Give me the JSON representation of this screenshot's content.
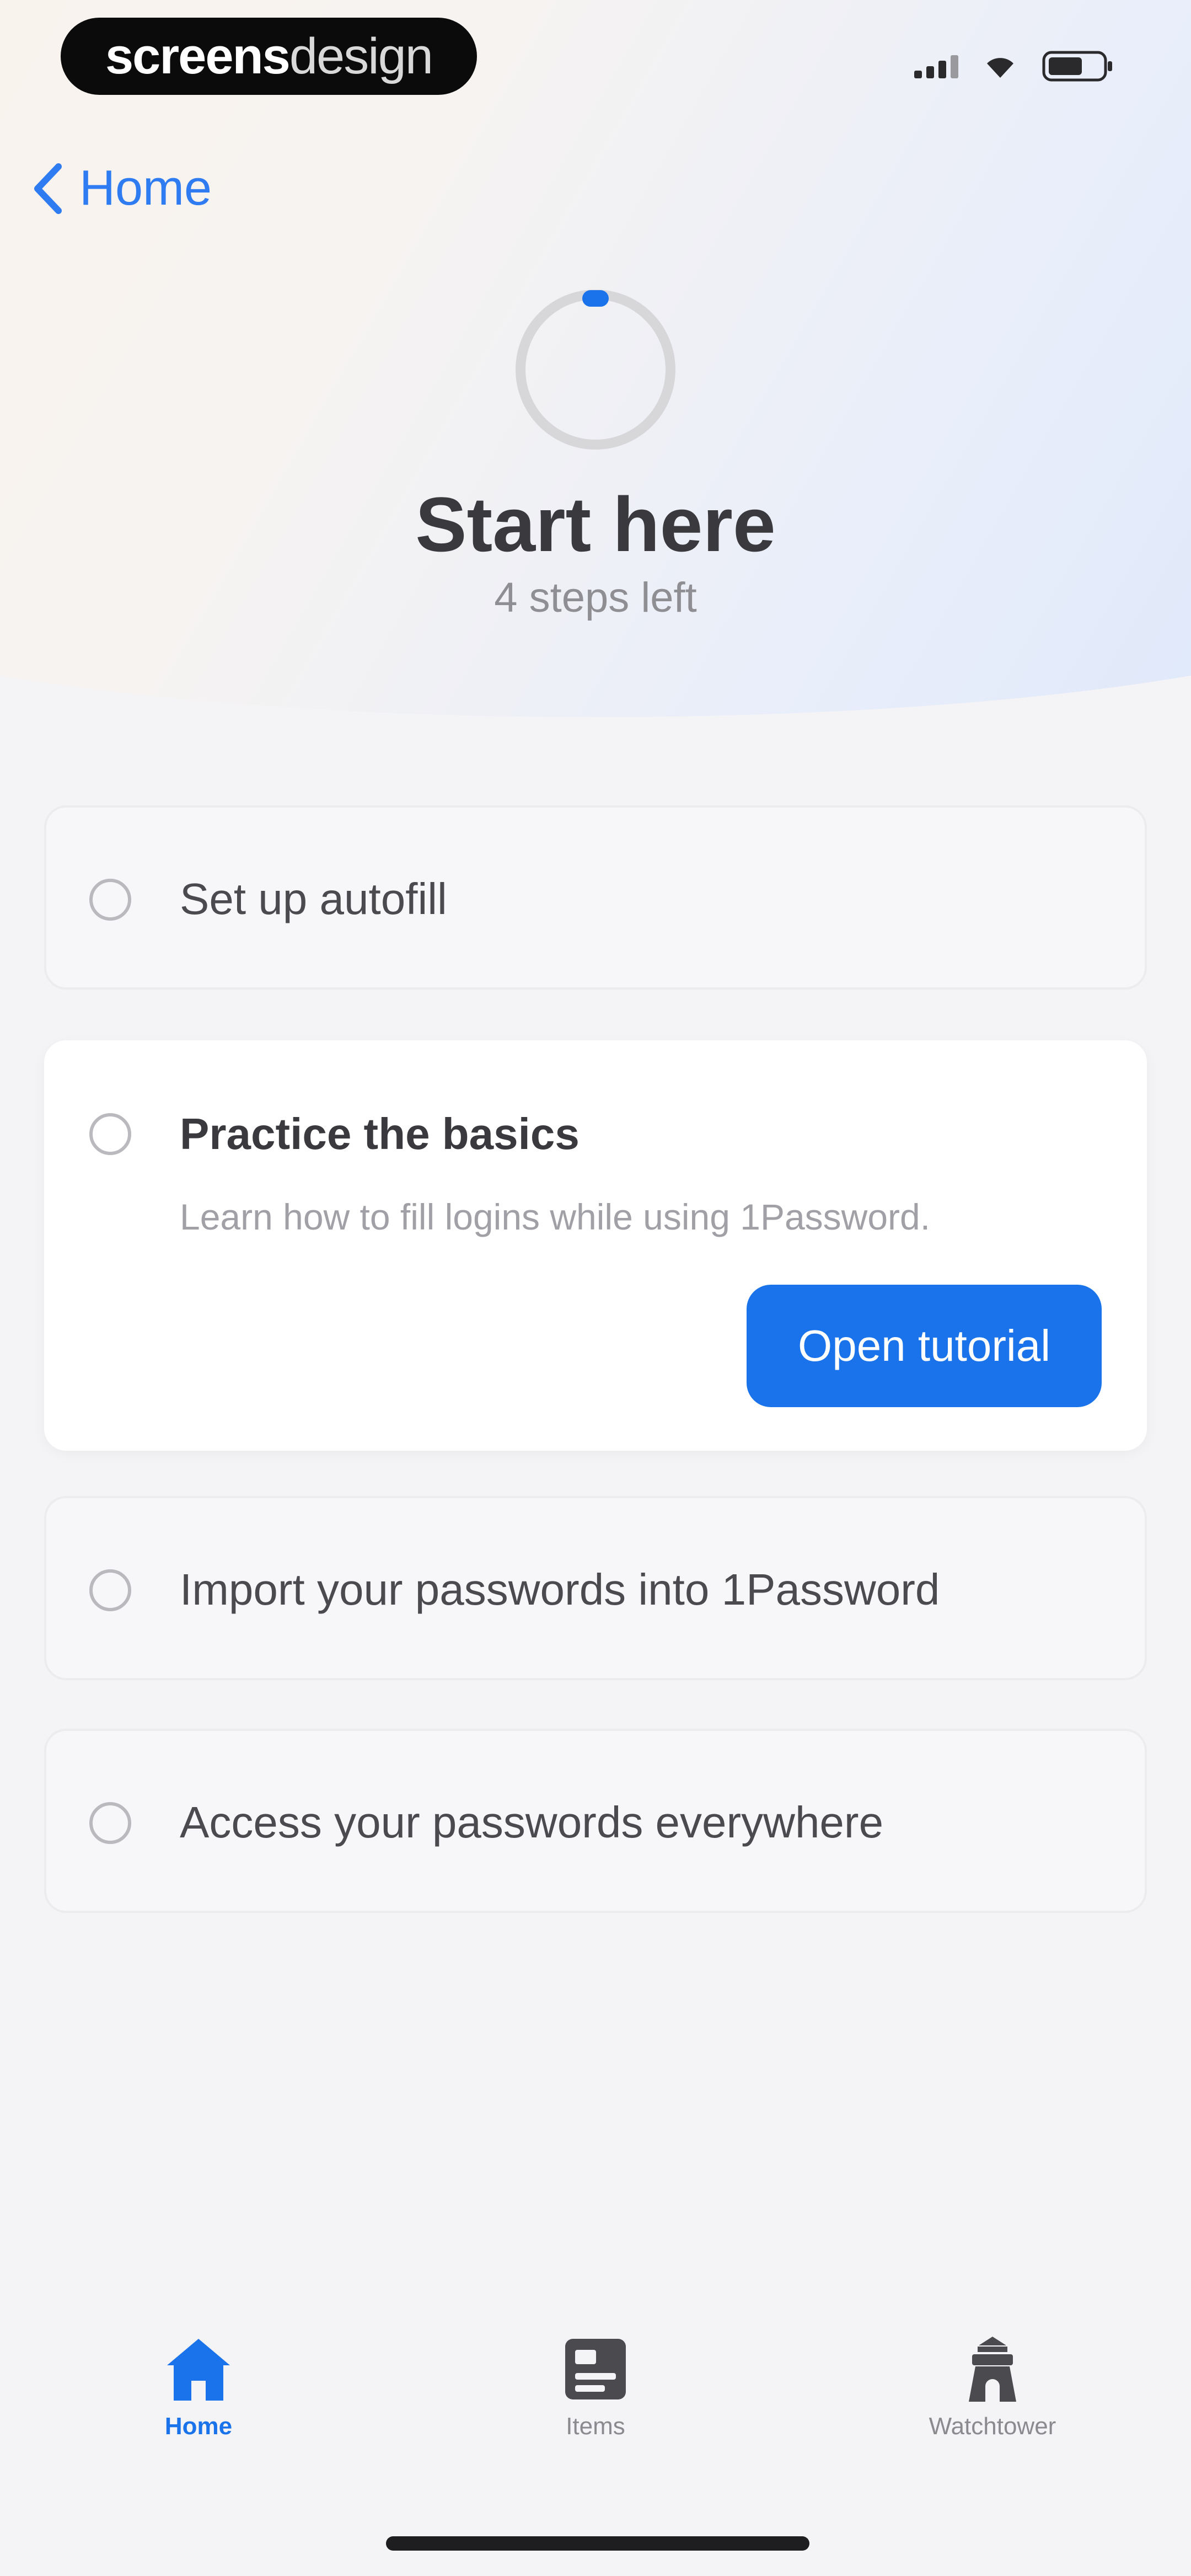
{
  "status_bar": {
    "brand_bold": "screens",
    "brand_light": "design",
    "icons": [
      "cellular-signal-icon",
      "wifi-icon",
      "battery-icon"
    ]
  },
  "nav": {
    "back_label": "Home",
    "back_icon": "chevron-left-icon"
  },
  "header": {
    "title": "Start here",
    "subtitle": "4 steps left",
    "progress_fraction": 0
  },
  "steps": [
    {
      "label": "Set up autofill",
      "completed": false,
      "expanded": false
    },
    {
      "label": "Practice the basics",
      "description": "Learn how to fill logins while using 1Password.",
      "button_label": "Open tutorial",
      "completed": false,
      "expanded": true
    },
    {
      "label": "Import your passwords into 1Password",
      "completed": false,
      "expanded": false
    },
    {
      "label": "Access your passwords everywhere",
      "completed": false,
      "expanded": false
    }
  ],
  "tabbar": {
    "tabs": [
      {
        "label": "Home",
        "icon": "house-icon",
        "active": true
      },
      {
        "label": "Items",
        "icon": "items-icon",
        "active": false
      },
      {
        "label": "Watchtower",
        "icon": "watchtower-icon",
        "active": false
      }
    ]
  },
  "colors": {
    "accent": "#1A73EB",
    "link": "#2F7BF1",
    "background": "#F4F3F6"
  }
}
